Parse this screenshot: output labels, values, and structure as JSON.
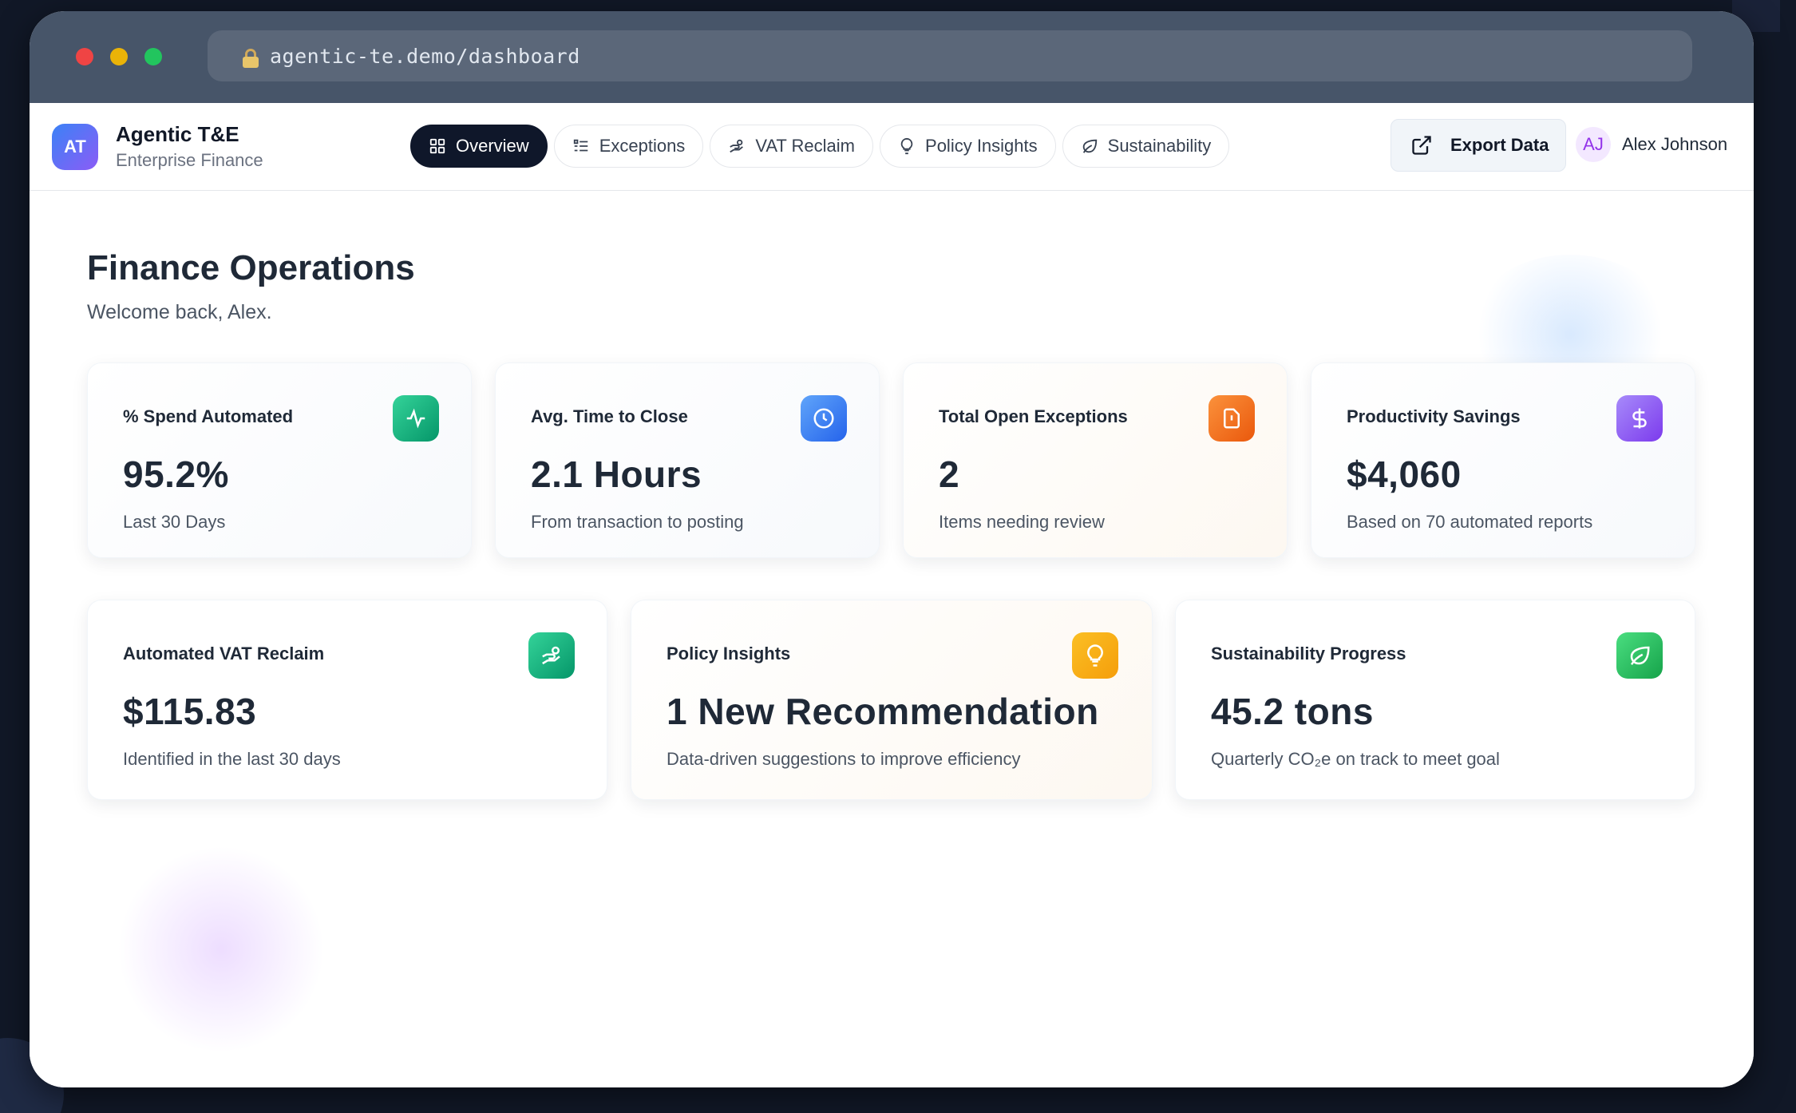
{
  "browser": {
    "url": "agentic-te.demo/dashboard"
  },
  "app": {
    "badge": "AT",
    "name": "Agentic T&E",
    "subtitle": "Enterprise Finance"
  },
  "tabs": [
    {
      "label": "Overview",
      "icon": "grid-icon",
      "active": true
    },
    {
      "label": "Exceptions",
      "icon": "list-icon",
      "active": false
    },
    {
      "label": "VAT Reclaim",
      "icon": "hand-coins-icon",
      "active": false
    },
    {
      "label": "Policy Insights",
      "icon": "lightbulb-icon",
      "active": false
    },
    {
      "label": "Sustainability",
      "icon": "leaf-icon",
      "active": false
    }
  ],
  "header": {
    "export_label": "Export Data",
    "user_initials": "AJ",
    "user_name": "Alex Johnson"
  },
  "page": {
    "title": "Finance Operations",
    "subtitle": "Welcome back, Alex."
  },
  "kpis": [
    {
      "label": "% Spend Automated",
      "value": "95.2%",
      "desc": "Last 30 Days",
      "icon": "activity-icon",
      "color": "#16a34a"
    },
    {
      "label": "Avg. Time to Close",
      "value": "2.1 Hours",
      "desc": "From transaction to posting",
      "icon": "clock-icon",
      "color": "#2563eb"
    },
    {
      "label": "Total Open Exceptions",
      "value": "2",
      "desc": "Items needing review",
      "icon": "alert-file-icon",
      "color": "#ea580c"
    },
    {
      "label": "Productivity Savings",
      "value": "$4,060",
      "desc": "Based on 70 automated reports",
      "icon": "dollar-icon",
      "color": "#7c3aed"
    }
  ],
  "features": [
    {
      "label": "Automated VAT Reclaim",
      "value": "$115.83",
      "desc": "Identified in the last 30 days",
      "icon": "hand-coins-icon",
      "color": "#059669"
    },
    {
      "label": "Policy Insights",
      "value": "1 New Recommendation",
      "desc": "Data-driven suggestions to improve efficiency",
      "icon": "lightbulb-icon",
      "color": "#f59e0b"
    },
    {
      "label": "Sustainability Progress",
      "value": "45.2 tons",
      "desc": "Quarterly CO₂e on track to meet goal",
      "icon": "leaf-icon",
      "color": "#16a34a"
    }
  ]
}
